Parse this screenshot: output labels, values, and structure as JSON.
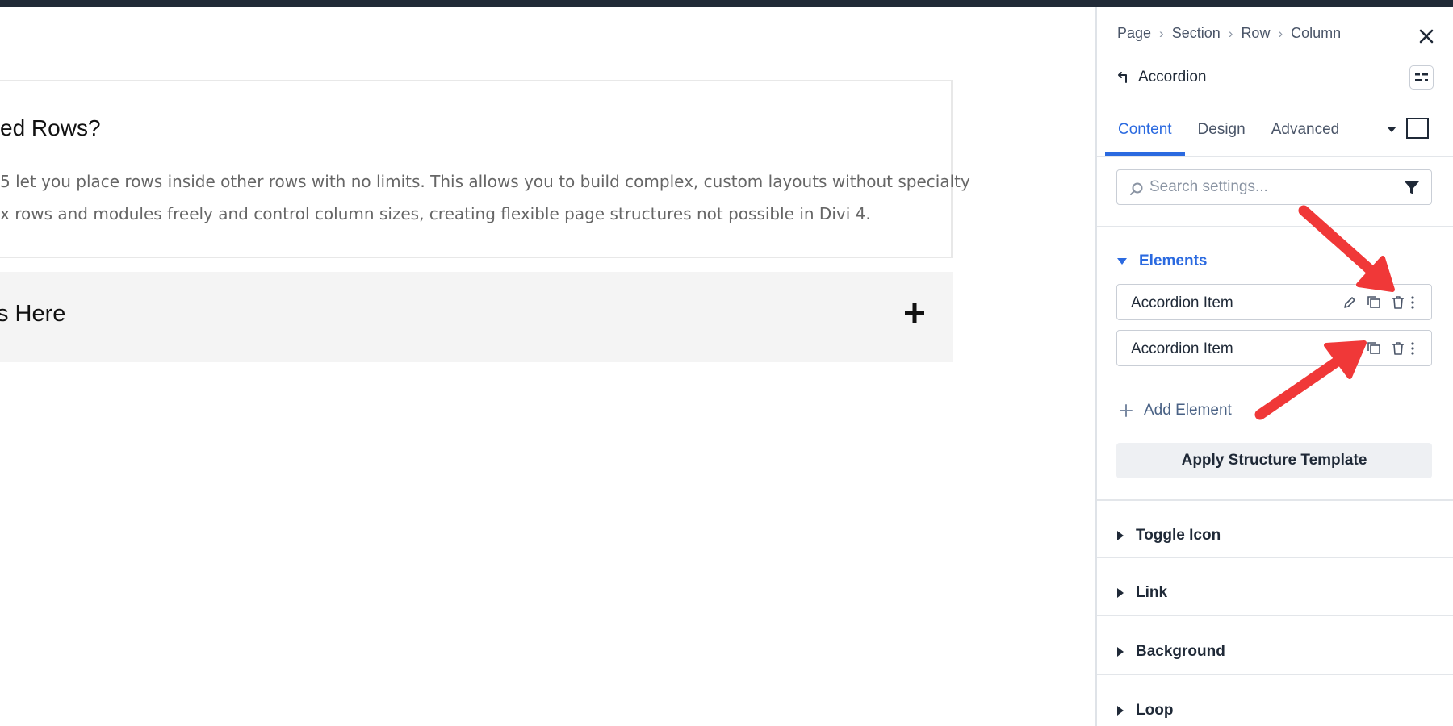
{
  "canvas": {
    "open_item": {
      "title": "ed Rows?",
      "body_lines": [
        "5 let you place rows inside other rows with no limits. This allows you to build complex, custom layouts without specialty",
        "x rows and modules freely and control column sizes, creating flexible page structures not possible in Divi 4."
      ]
    },
    "closed_item": {
      "title": "s Here"
    }
  },
  "panel": {
    "breadcrumb": [
      "Page",
      "Section",
      "Row",
      "Column"
    ],
    "breadcrumb_separator": "›",
    "module_title": "Accordion",
    "tabs": [
      {
        "label": "Content",
        "active": true
      },
      {
        "label": "Design",
        "active": false
      },
      {
        "label": "Advanced",
        "active": false
      }
    ],
    "search": {
      "placeholder": "Search settings...",
      "value": ""
    },
    "elements": {
      "label": "Elements",
      "items": [
        {
          "label": "Accordion Item"
        },
        {
          "label": "Accordion Item"
        }
      ],
      "add_label": "Add Element",
      "apply_label": "Apply Structure Template"
    },
    "groups": [
      {
        "label": "Toggle Icon"
      },
      {
        "label": "Link"
      },
      {
        "label": "Background"
      },
      {
        "label": "Loop"
      }
    ]
  },
  "colors": {
    "accent": "#2b6ae0",
    "annotation_arrow": "#f03838",
    "topbar": "#212a37"
  },
  "icons": {
    "close": "close-icon",
    "back": "back-arrow-icon",
    "search": "search-icon",
    "filter": "filter-icon",
    "edit": "pencil-icon",
    "duplicate": "duplicate-icon",
    "delete": "trash-icon",
    "more": "more-vertical-icon"
  }
}
